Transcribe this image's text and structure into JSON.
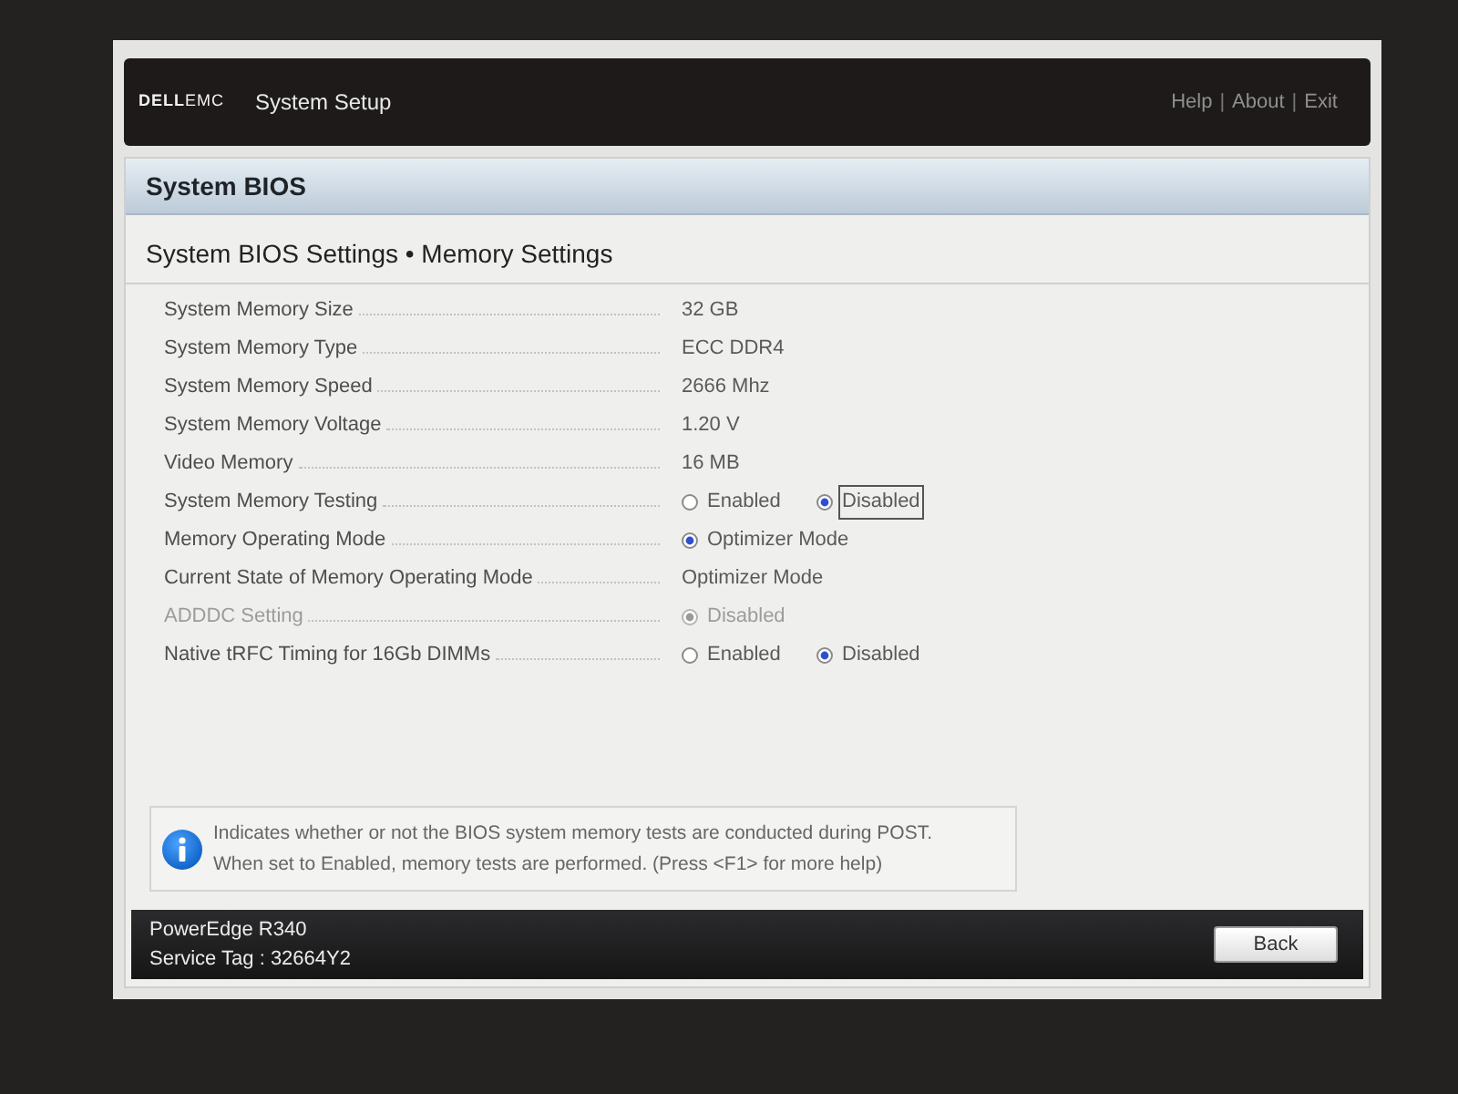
{
  "header": {
    "logo": "**DELL**EMC",
    "title": "System Setup",
    "links": [
      {
        "label": "Help"
      },
      {
        "label": "About"
      },
      {
        "label": "Exit"
      }
    ],
    "separator": "|"
  },
  "panel": {
    "title": "System BIOS",
    "breadcrumb": "System BIOS Settings • Memory Settings"
  },
  "settings": [
    {
      "kind": "text",
      "label": "System Memory Size",
      "value": "32 GB",
      "disabled": false
    },
    {
      "kind": "text",
      "label": "System Memory Type",
      "value": "ECC DDR4",
      "disabled": false
    },
    {
      "kind": "text",
      "label": "System Memory Speed",
      "value": "2666 Mhz",
      "disabled": false
    },
    {
      "kind": "text",
      "label": "System Memory Voltage",
      "value": "1.20 V",
      "disabled": false
    },
    {
      "kind": "text",
      "label": "Video Memory",
      "value": "16 MB",
      "disabled": false
    },
    {
      "kind": "radio",
      "label": "System Memory Testing",
      "disabled": false,
      "options": [
        {
          "label": "Enabled",
          "selected": false,
          "focused": false
        },
        {
          "label": "Disabled",
          "selected": true,
          "focused": true
        }
      ]
    },
    {
      "kind": "radio",
      "label": "Memory Operating Mode",
      "disabled": false,
      "options": [
        {
          "label": "Optimizer Mode",
          "selected": true,
          "focused": false
        }
      ]
    },
    {
      "kind": "text",
      "label": "Current State of Memory Operating Mode",
      "value": "Optimizer Mode",
      "disabled": false
    },
    {
      "kind": "radio",
      "label": "ADDDC Setting",
      "disabled": true,
      "options": [
        {
          "label": "Disabled",
          "selected": true,
          "focused": false
        }
      ]
    },
    {
      "kind": "radio",
      "label": "Native tRFC Timing for 16Gb DIMMs",
      "disabled": false,
      "options": [
        {
          "label": "Enabled",
          "selected": false,
          "focused": false
        },
        {
          "label": "Disabled",
          "selected": true,
          "focused": false
        }
      ]
    }
  ],
  "help": {
    "text": "Indicates whether or not the BIOS system memory tests are conducted during POST.\nWhen set to Enabled, memory tests are performed. (Press <F1> for more help)"
  },
  "footer": {
    "model": "PowerEdge R340",
    "service_tag": "Service Tag : 32664Y2",
    "buttons": [
      {
        "label": "Back"
      }
    ]
  }
}
